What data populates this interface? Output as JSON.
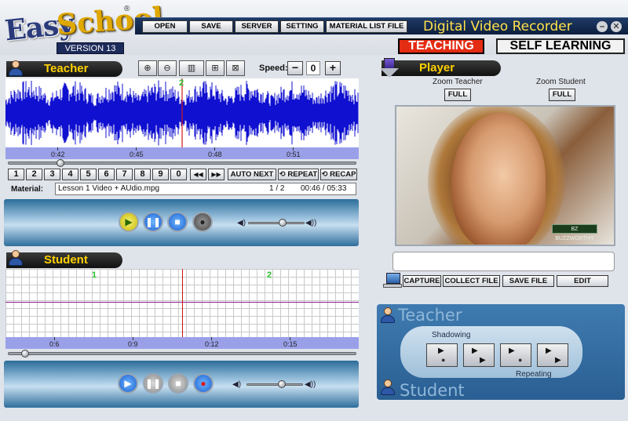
{
  "logo": {
    "easy": "Easy",
    "school": "School",
    "reg": "®",
    "version": "VERSION 13"
  },
  "menu": {
    "items": [
      "OPEN",
      "SAVE",
      "SERVER",
      "SETTING",
      "MATERIAL LIST FILE"
    ],
    "app_title": "Digital Video Recorder",
    "minimize": "–",
    "close": "✕"
  },
  "modes": {
    "teaching": "TEACHING",
    "self_learning": "SELF LEARNING",
    "active": "TEACHING"
  },
  "teacher": {
    "title": "Teacher",
    "speed_label": "Speed:",
    "speed_minus": "−",
    "speed_value": "0",
    "speed_plus": "+",
    "timeline_ticks": [
      "0:42",
      "0:45",
      "0:48",
      "0:51"
    ],
    "marker": "2",
    "position_fraction": 0.15
  },
  "numbers": [
    "1",
    "2",
    "3",
    "4",
    "5",
    "6",
    "7",
    "8",
    "9",
    "0"
  ],
  "nav": {
    "prev": "◀◀",
    "next": "▶▶",
    "auto_next": "AUTO NEXT",
    "repeat": "⟲ REPEAT",
    "recap": "⟲ RECAP"
  },
  "material": {
    "label": "Material:",
    "file": "Lesson 1 Video + AUdio.mpg",
    "index": "1 / 2",
    "time": "00:46 / 05:33"
  },
  "student": {
    "title": "Student",
    "markers": [
      "1",
      "2"
    ],
    "timeline_ticks": [
      "0:6",
      "0:9",
      "0:12",
      "0:15"
    ],
    "position_fraction": 0.05
  },
  "player": {
    "title": "Player",
    "zoom_teacher": "Zoom Teacher",
    "zoom_student": "Zoom Student",
    "full": "FULL",
    "badge": "BZ BUZZWORTHY",
    "caption": ""
  },
  "actions": [
    "CAPTURE",
    "COLLECT FILE",
    "SAVE FILE",
    "EDIT"
  ],
  "shadow": {
    "teacher": "Teacher",
    "student": "Student",
    "shadowing": "Shadowing",
    "repeating": "Repeating"
  },
  "colors": {
    "wave": "#1010d0",
    "accent_red": "#e32c12",
    "title_yellow": "#ffe24a"
  }
}
